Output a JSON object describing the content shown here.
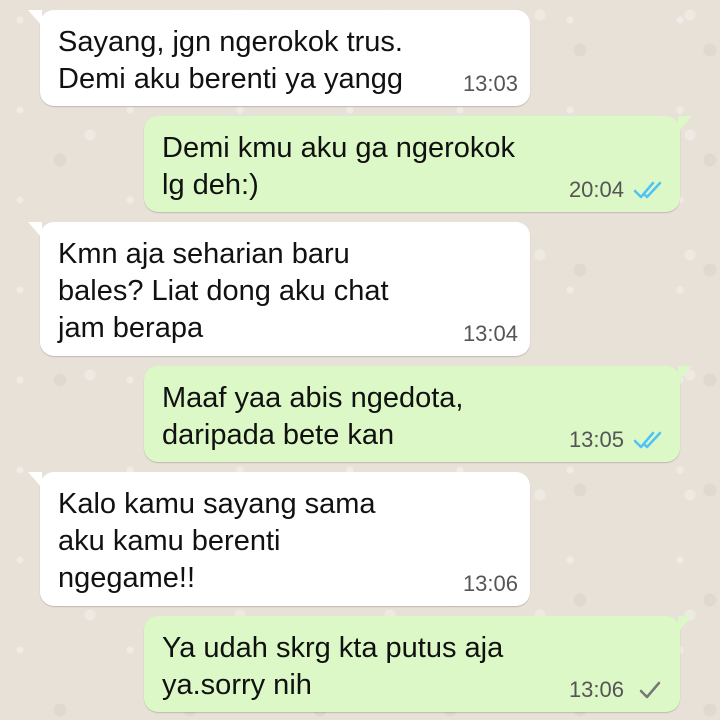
{
  "colors": {
    "background": "#ece5dd",
    "incoming_bubble": "#ffffff",
    "outgoing_bubble": "#dcf8c6",
    "read_ticks": "#4fc3f7",
    "sent_tick": "#777777"
  },
  "messages": [
    {
      "direction": "incoming",
      "text": "Sayang, jgn ngerokok trus.\nDemi aku berenti ya yangg",
      "time": "13:03"
    },
    {
      "direction": "outgoing",
      "text": "Demi kmu aku ga ngerokok\nlg deh:)",
      "time": "20:04",
      "status_icon": "double-check-read-icon"
    },
    {
      "direction": "incoming",
      "text": "Kmn aja seharian baru\nbales? Liat dong aku chat\njam berapa",
      "time": "13:04"
    },
    {
      "direction": "outgoing",
      "text": "Maaf yaa abis ngedota,\ndaripada bete kan",
      "time": "13:05",
      "status_icon": "double-check-read-icon"
    },
    {
      "direction": "incoming",
      "text": "Kalo kamu sayang sama\naku kamu berenti\nngegame!!",
      "time": "13:06"
    },
    {
      "direction": "outgoing",
      "text": "Ya udah skrg kta putus aja\nya.sorry nih",
      "time": "13:06",
      "status_icon": "single-check-sent-icon"
    }
  ]
}
